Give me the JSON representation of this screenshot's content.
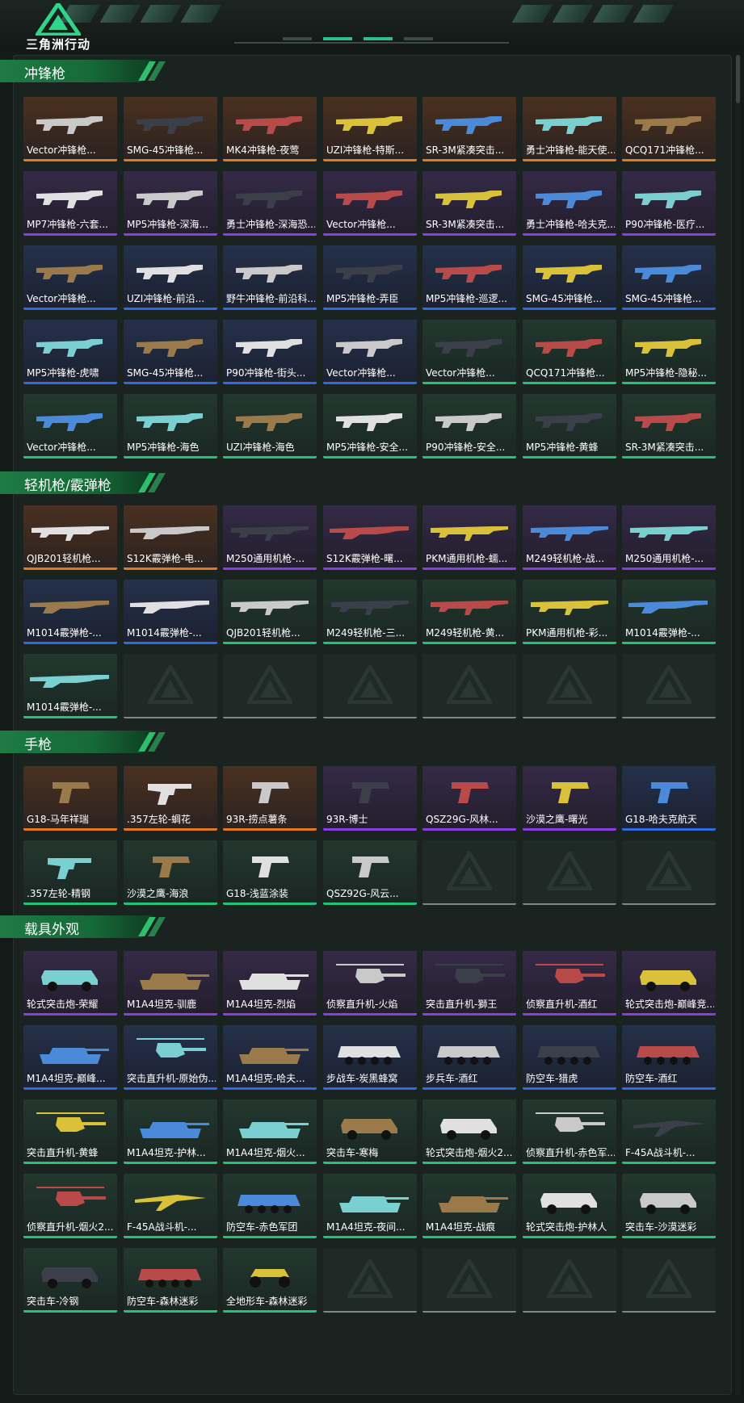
{
  "app": {
    "logo_text": "三角洲行动"
  },
  "colors": {
    "accent": "#22c27a",
    "rarity_orange": "#e07a22",
    "rarity_purple": "#8a3ee0",
    "rarity_blue": "#2d6be0",
    "rarity_green": "#22c27a",
    "empty_slot": "#1f2a26"
  },
  "sections": [
    {
      "title": "冲锋枪",
      "items": [
        {
          "label": "Vector冲锋枪...",
          "rarity": "orange",
          "icon": "smg-icon"
        },
        {
          "label": "SMG-45冲锋枪...",
          "rarity": "orange",
          "icon": "smg-icon"
        },
        {
          "label": "MK4冲锋枪-夜莺",
          "rarity": "orange",
          "icon": "smg-icon"
        },
        {
          "label": "UZI冲锋枪-特斯...",
          "rarity": "orange",
          "icon": "smg-icon"
        },
        {
          "label": "SR-3M紧凑突击...",
          "rarity": "orange",
          "icon": "smg-icon"
        },
        {
          "label": "勇士冲锋枪-能天使...",
          "rarity": "orange",
          "icon": "smg-icon"
        },
        {
          "label": "QCQ171冲锋枪...",
          "rarity": "orange",
          "icon": "smg-icon"
        },
        {
          "label": "MP7冲锋枪-六套...",
          "rarity": "purple",
          "icon": "smg-icon"
        },
        {
          "label": "MP5冲锋枪-深海...",
          "rarity": "purple",
          "icon": "smg-icon"
        },
        {
          "label": "勇士冲锋枪-深海恐...",
          "rarity": "purple",
          "icon": "smg-icon"
        },
        {
          "label": "Vector冲锋枪...",
          "rarity": "purple",
          "icon": "smg-icon"
        },
        {
          "label": "SR-3M紧凑突击...",
          "rarity": "purple",
          "icon": "smg-icon"
        },
        {
          "label": "勇士冲锋枪-哈夫克...",
          "rarity": "purple",
          "icon": "smg-icon"
        },
        {
          "label": "P90冲锋枪-医疗...",
          "rarity": "purple",
          "icon": "smg-icon"
        },
        {
          "label": "Vector冲锋枪...",
          "rarity": "blue",
          "icon": "smg-icon"
        },
        {
          "label": "UZI冲锋枪-前沿...",
          "rarity": "blue",
          "icon": "smg-icon"
        },
        {
          "label": "野牛冲锋枪-前沿科...",
          "rarity": "blue",
          "icon": "smg-icon"
        },
        {
          "label": "MP5冲锋枪-弄臣",
          "rarity": "blue",
          "icon": "smg-icon"
        },
        {
          "label": "MP5冲锋枪-巡逻...",
          "rarity": "blue",
          "icon": "smg-icon"
        },
        {
          "label": "SMG-45冲锋枪...",
          "rarity": "blue",
          "icon": "smg-icon"
        },
        {
          "label": "SMG-45冲锋枪...",
          "rarity": "blue",
          "icon": "smg-icon"
        },
        {
          "label": "MP5冲锋枪-虎啸",
          "rarity": "blue",
          "icon": "smg-icon"
        },
        {
          "label": "SMG-45冲锋枪...",
          "rarity": "blue",
          "icon": "smg-icon"
        },
        {
          "label": "P90冲锋枪-街头...",
          "rarity": "blue",
          "icon": "smg-icon"
        },
        {
          "label": "Vector冲锋枪...",
          "rarity": "blue",
          "icon": "smg-icon"
        },
        {
          "label": "Vector冲锋枪...",
          "rarity": "green",
          "icon": "smg-icon"
        },
        {
          "label": "QCQ171冲锋枪...",
          "rarity": "green",
          "icon": "smg-icon"
        },
        {
          "label": "MP5冲锋枪-隐秘...",
          "rarity": "green",
          "icon": "smg-icon"
        },
        {
          "label": "Vector冲锋枪...",
          "rarity": "green",
          "icon": "smg-icon"
        },
        {
          "label": "MP5冲锋枪-海色",
          "rarity": "green",
          "icon": "smg-icon"
        },
        {
          "label": "UZI冲锋枪-海色",
          "rarity": "green",
          "icon": "smg-icon"
        },
        {
          "label": "MP5冲锋枪-安全...",
          "rarity": "green",
          "icon": "smg-icon"
        },
        {
          "label": "P90冲锋枪-安全...",
          "rarity": "green",
          "icon": "smg-icon"
        },
        {
          "label": "MP5冲锋枪-黄蜂",
          "rarity": "green",
          "icon": "smg-icon"
        },
        {
          "label": "SR-3M紧凑突击...",
          "rarity": "green",
          "icon": "smg-icon"
        }
      ]
    },
    {
      "title": "轻机枪/霰弹枪",
      "items": [
        {
          "label": "QJB201轻机枪...",
          "rarity": "orange",
          "icon": "lmg-icon"
        },
        {
          "label": "S12K霰弹枪-电...",
          "rarity": "orange",
          "icon": "shotgun-icon"
        },
        {
          "label": "M250通用机枪-...",
          "rarity": "purple",
          "icon": "lmg-icon"
        },
        {
          "label": "S12K霰弹枪-曙...",
          "rarity": "purple",
          "icon": "shotgun-icon"
        },
        {
          "label": "PKM通用机枪-蠕...",
          "rarity": "purple",
          "icon": "lmg-icon"
        },
        {
          "label": "M249轻机枪-战...",
          "rarity": "purple",
          "icon": "lmg-icon"
        },
        {
          "label": "M250通用机枪-...",
          "rarity": "purple",
          "icon": "lmg-icon"
        },
        {
          "label": "M1014霰弹枪-...",
          "rarity": "blue",
          "icon": "shotgun-icon"
        },
        {
          "label": "M1014霰弹枪-...",
          "rarity": "blue",
          "icon": "shotgun-icon"
        },
        {
          "label": "QJB201轻机枪...",
          "rarity": "green",
          "icon": "lmg-icon"
        },
        {
          "label": "M249轻机枪-三...",
          "rarity": "green",
          "icon": "lmg-icon"
        },
        {
          "label": "M249轻机枪-黄...",
          "rarity": "green",
          "icon": "lmg-icon"
        },
        {
          "label": "PKM通用机枪-彩...",
          "rarity": "green",
          "icon": "lmg-icon"
        },
        {
          "label": "M1014霰弹枪-...",
          "rarity": "green",
          "icon": "shotgun-icon"
        },
        {
          "label": "M1014霰弹枪-...",
          "rarity": "green",
          "icon": "shotgun-icon"
        },
        {
          "label": "",
          "rarity": "empty"
        },
        {
          "label": "",
          "rarity": "empty"
        },
        {
          "label": "",
          "rarity": "empty"
        },
        {
          "label": "",
          "rarity": "empty"
        },
        {
          "label": "",
          "rarity": "empty"
        },
        {
          "label": "",
          "rarity": "empty"
        }
      ]
    },
    {
      "title": "手枪",
      "items": [
        {
          "label": "G18-马年祥瑞",
          "rarity": "orange",
          "icon": "pistol-icon"
        },
        {
          "label": ".357左轮-蜩花",
          "rarity": "orange",
          "icon": "revolver-icon"
        },
        {
          "label": "93R-捞点薯条",
          "rarity": "orange",
          "icon": "pistol-icon"
        },
        {
          "label": "93R-博士",
          "rarity": "purple",
          "icon": "pistol-icon"
        },
        {
          "label": "QSZ29G-风林...",
          "rarity": "purple",
          "icon": "pistol-icon"
        },
        {
          "label": "沙漠之鹰-曙光",
          "rarity": "purple",
          "icon": "pistol-icon"
        },
        {
          "label": "G18-哈夫克航天",
          "rarity": "blue",
          "icon": "pistol-icon"
        },
        {
          "label": ".357左轮-精钢",
          "rarity": "green",
          "icon": "revolver-icon"
        },
        {
          "label": "沙漠之鹰-海浪",
          "rarity": "green",
          "icon": "pistol-icon"
        },
        {
          "label": "G18-浅蓝涂装",
          "rarity": "green",
          "icon": "pistol-icon"
        },
        {
          "label": "QSZ92G-风云...",
          "rarity": "green",
          "icon": "pistol-icon"
        },
        {
          "label": "",
          "rarity": "empty"
        },
        {
          "label": "",
          "rarity": "empty"
        },
        {
          "label": "",
          "rarity": "empty"
        }
      ]
    },
    {
      "title": "载具外观",
      "items": [
        {
          "label": "轮式突击炮-荣耀",
          "rarity": "purple",
          "icon": "vehicle-icon"
        },
        {
          "label": "M1A4坦克-驯鹿",
          "rarity": "purple",
          "icon": "tank-icon"
        },
        {
          "label": "M1A4坦克-烈焰",
          "rarity": "purple",
          "icon": "tank-icon"
        },
        {
          "label": "侦察直升机-火焰",
          "rarity": "purple",
          "icon": "helicopter-icon"
        },
        {
          "label": "突击直升机-獅王",
          "rarity": "purple",
          "icon": "helicopter-icon"
        },
        {
          "label": "侦察直升机-酒红",
          "rarity": "purple",
          "icon": "helicopter-icon"
        },
        {
          "label": "轮式突击炮-巅峰竞...",
          "rarity": "purple",
          "icon": "vehicle-icon"
        },
        {
          "label": "M1A4坦克-巅峰...",
          "rarity": "blue",
          "icon": "tank-icon"
        },
        {
          "label": "突击直升机-原始伪...",
          "rarity": "blue",
          "icon": "helicopter-icon"
        },
        {
          "label": "M1A4坦克-哈夫...",
          "rarity": "blue",
          "icon": "tank-icon"
        },
        {
          "label": "步战车-炭黑蜂窝",
          "rarity": "blue",
          "icon": "apc-icon"
        },
        {
          "label": "步兵车-酒红",
          "rarity": "blue",
          "icon": "apc-icon"
        },
        {
          "label": "防空车-猎虎",
          "rarity": "blue",
          "icon": "apc-icon"
        },
        {
          "label": "防空车-酒红",
          "rarity": "blue",
          "icon": "apc-icon"
        },
        {
          "label": "突击直升机-黄蜂",
          "rarity": "green",
          "icon": "helicopter-icon"
        },
        {
          "label": "M1A4坦克-护林...",
          "rarity": "green",
          "icon": "tank-icon"
        },
        {
          "label": "M1A4坦克-烟火...",
          "rarity": "green",
          "icon": "tank-icon"
        },
        {
          "label": "突击车-寒梅",
          "rarity": "green",
          "icon": "vehicle-icon"
        },
        {
          "label": "轮式突击炮-烟火2...",
          "rarity": "green",
          "icon": "vehicle-icon"
        },
        {
          "label": "侦察直升机-赤色军...",
          "rarity": "green",
          "icon": "helicopter-icon"
        },
        {
          "label": "F-45A战斗机-...",
          "rarity": "green",
          "icon": "jet-icon"
        },
        {
          "label": "侦察直升机-烟火2...",
          "rarity": "green",
          "icon": "helicopter-icon"
        },
        {
          "label": "F-45A战斗机-...",
          "rarity": "green",
          "icon": "jet-icon"
        },
        {
          "label": "防空车-赤色军团",
          "rarity": "green",
          "icon": "apc-icon"
        },
        {
          "label": "M1A4坦克-夜间...",
          "rarity": "green",
          "icon": "tank-icon"
        },
        {
          "label": "M1A4坦克-战痕",
          "rarity": "green",
          "icon": "tank-icon"
        },
        {
          "label": "轮式突击炮-护林人",
          "rarity": "green",
          "icon": "vehicle-icon"
        },
        {
          "label": "突击车-沙漠迷彩",
          "rarity": "green",
          "icon": "vehicle-icon"
        },
        {
          "label": "突击车-冷钢",
          "rarity": "green",
          "icon": "vehicle-icon"
        },
        {
          "label": "防空车-森林迷彩",
          "rarity": "green",
          "icon": "apc-icon"
        },
        {
          "label": "全地形车-森林迷彩",
          "rarity": "green",
          "icon": "atv-icon"
        },
        {
          "label": "",
          "rarity": "empty"
        },
        {
          "label": "",
          "rarity": "empty"
        },
        {
          "label": "",
          "rarity": "empty"
        },
        {
          "label": "",
          "rarity": "empty"
        }
      ]
    }
  ]
}
